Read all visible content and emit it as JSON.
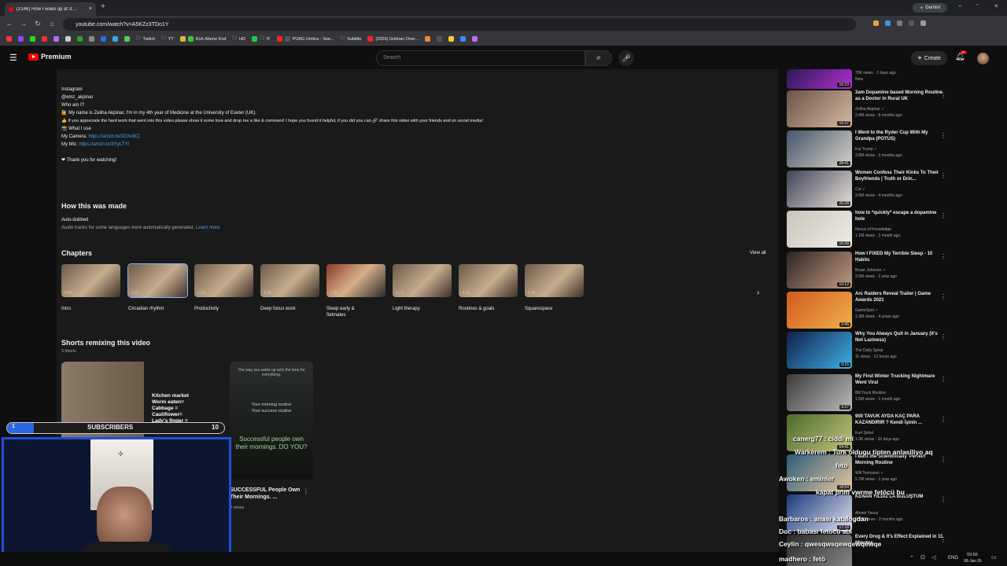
{
  "browser": {
    "tab_title": "(2146) How I wake up at 3:...",
    "url": "youtube.com/watch?v=A5KZz3TDo1Y",
    "gemini": "Gemini",
    "bookmarks": [
      "Twitch",
      "YT",
      "Kick Abone Kod",
      "HD",
      "IY",
      "PUBG Umbra - See...",
      "Subtitle",
      "(2026) Gokhan Oner..."
    ]
  },
  "header": {
    "brand": "Premium",
    "search_placeholder": "Search",
    "create": "Create",
    "notif_count": "9+"
  },
  "description": {
    "lines": [
      "Instagram",
      "@emz_akpinar",
      "",
      "Who am I?",
      "🙋 My name is Zeliha Akpinar, I'm in my 4th year of Medicine at the University of Exeter (UK).",
      "",
      "👍 If you appreciate the hard work that went into this video please show it some love and drop me a like & comment! I hope you found it helpful, if you did you can 🔗 share this video with your friends and on social media!",
      "",
      "📸 What I use"
    ],
    "camera_label": "My Camera:",
    "camera_link": "https://amzn.to/3OXc8Cj",
    "mic_label": "My Mic:",
    "mic_link": "https://amzn.to/3YyLTYf",
    "thanks": "❤ Thank you for watching!"
  },
  "how_made": {
    "title": "How this was made",
    "label": "Auto-dubbed",
    "text": "Audio tracks for some languages were automatically generated.",
    "link": "Learn more"
  },
  "chapters": {
    "title": "Chapters",
    "view_all": "View all",
    "items": [
      {
        "time": "0:00",
        "label": "Intro"
      },
      {
        "time": "0:21",
        "label": "Circadian rhythm"
      },
      {
        "time": "1:02",
        "label": "Productivity"
      },
      {
        "time": "1:35",
        "label": "Deep focus work"
      },
      {
        "time": "1:58",
        "label": "Sleep early &\nflatmates"
      },
      {
        "time": "3:12",
        "label": "Light therapy"
      },
      {
        "time": "4:39",
        "label": "Routines & goals"
      },
      {
        "time": "5:15",
        "label": "Squarespace"
      }
    ]
  },
  "shorts": {
    "title": "Shorts remixing this video",
    "count": "3 Shorts",
    "s1_text": [
      "Kitchen market",
      "Worm eaten=",
      "Cabbage =",
      "Cauliflower=",
      "Lady's finger ="
    ],
    "s2_top": "The way you wake up sets the tone for everything.",
    "s2_mid1": "Your morning routine",
    "s2_mid2": "Your success routine",
    "s2_big": "Successful people own their mornings. DO YOU?",
    "s2_title": "SUCCESSFUL People Own Their Mornings. ...",
    "s2_views": "0 views"
  },
  "recommendations": [
    {
      "title": "",
      "channel": "75K views · 2 days ago",
      "meta": "New",
      "dur": "16:23",
      "c1": "#2a1a55",
      "c2": "#b02fd0"
    },
    {
      "title": "3am Dopamine based Morning Routine as a Doctor in Rural UK",
      "channel": "Zeliha Akpinar ✓",
      "meta": "2.4M views · 8 months ago",
      "dur": "10:37",
      "c1": "#6a5246",
      "c2": "#d7b9a3"
    },
    {
      "title": "I Went to the Ryder Cup With My Grandpa (POTUS)",
      "channel": "Kai Trump ✓",
      "meta": "2.8M views · 2 months ago",
      "dur": "28:41",
      "c1": "#45556a",
      "c2": "#d6d2c9"
    },
    {
      "title": "Women Confess Their Kinks To Their Boyfriends | Truth or Drin...",
      "channel": "Cut ✓",
      "meta": "3.5M views · 4 months ago",
      "dur": "20:28",
      "c1": "#40435a",
      "c2": "#e8e0d8"
    },
    {
      "title": "how to *quickly* escape a dopamine hole",
      "channel": "Nexus of Knowledge",
      "meta": "1.1M views · 1 month ago",
      "dur": "16:38",
      "c1": "#c9c4bb",
      "c2": "#efece6"
    },
    {
      "title": "How I FIXED My Terrible Sleep - 10 Habits",
      "channel": "Bryan Johnson ✓",
      "meta": "3.5M views · 1 year ago",
      "dur": "10:12",
      "c1": "#2d2320",
      "c2": "#c49a84"
    },
    {
      "title": "Arc Raiders Reveal Trailer | Game Awards 2021",
      "channel": "GameSpot ✓",
      "meta": "1.3M views · 4 years ago",
      "dur": "2:46",
      "c1": "#d15a1f",
      "c2": "#f0b04a"
    },
    {
      "title": "Why You Always Quit in January (It's Not Laziness)",
      "channel": "The Daily Spiral",
      "meta": "11 views · 12 hours ago",
      "dur": "6:15",
      "c1": "#101f4a",
      "c2": "#3fb0e8"
    },
    {
      "title": "My First Winter Trucking Nightmare Went Viral",
      "channel": "Bill Truck Routine",
      "meta": "1.5M views · 1 month ago",
      "dur": "9:27",
      "c1": "#3a3a3a",
      "c2": "#bcbcbc"
    },
    {
      "title": "900 TAVUK AYDA KAÇ PARA KAZANDIRIR ? Kendi İşinin ...",
      "channel": "Kurt Şirket",
      "meta": "1.3K views · 10 days ago",
      "dur": "54:41",
      "c1": "#4a6a2a",
      "c2": "#c4c480"
    },
    {
      "title": "I Built the Scientifically 'Perfect' Morning Routine",
      "channel": "Will Tennyson ✓",
      "meta": "5.7M views · 1 year ago",
      "dur": "18:54",
      "c1": "#2a5a7a",
      "c2": "#e8c8a0"
    },
    {
      "title": "KENAN YILDIZ'LA BULUŞTUM",
      "channel": "Ahmet Yavuz",
      "meta": "370K views · 2 months ago",
      "dur": "17:18",
      "c1": "#1a3a7a",
      "c2": "#e0e0f0"
    },
    {
      "title": "Every Drug & It's Effect Explained in 11 Minutes",
      "channel": "",
      "meta": "",
      "dur": "",
      "c1": "#2a2a2a",
      "c2": "#8a8a8a"
    }
  ],
  "overlay": {
    "subs_label": "SUBSCRIBERS",
    "subs_count": "10",
    "subs_current": "1",
    "chat": [
      "canerg77 : ciddi mi",
      "Warkerem : Turk oldugu tipten anlasiliyo aq",
      "feto",
      "Awoken : eminler",
      "kapat prim vwrme fetöcü bu",
      "Barbaros : anası katalogdan",
      "Doc : babası fetöcü abi",
      "Ceylin : qwesqwsqewqewqewqe",
      "madhero : fetö"
    ]
  },
  "taskbar": {
    "lang": "ENG",
    "time": "03:56",
    "date": "08-Jan-26"
  }
}
